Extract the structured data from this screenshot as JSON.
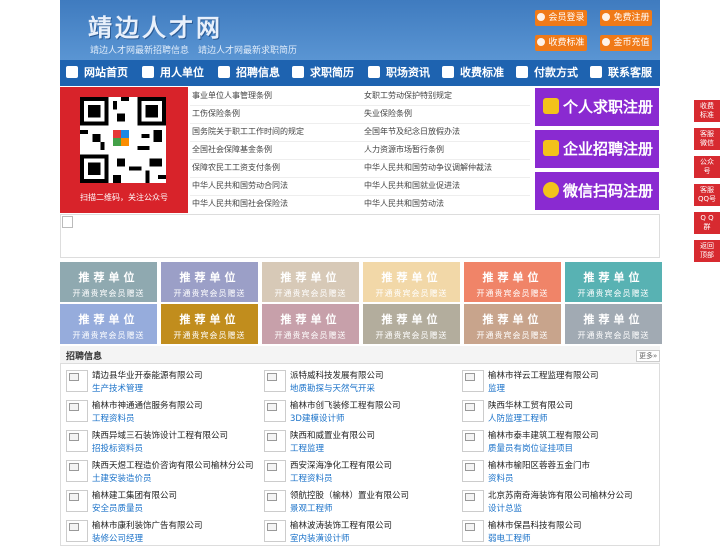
{
  "header": {
    "title": "靖边人才网",
    "subtitle": "靖边人才网最新招聘信息　靖边人才网最新求职简历",
    "buttons": [
      {
        "label": "会员登录",
        "icon": "user-icon"
      },
      {
        "label": "免费注册",
        "icon": "register-icon"
      },
      {
        "label": "收费标准",
        "icon": "price-icon"
      },
      {
        "label": "金币充值",
        "icon": "coin-icon"
      }
    ]
  },
  "nav": [
    {
      "label": "网站首页",
      "icon": "home-icon"
    },
    {
      "label": "用人单位",
      "icon": "building-icon"
    },
    {
      "label": "招聘信息",
      "icon": "recruit-icon"
    },
    {
      "label": "求职简历",
      "icon": "resume-icon"
    },
    {
      "label": "职场资讯",
      "icon": "news-icon"
    },
    {
      "label": "收费标准",
      "icon": "price-icon"
    },
    {
      "label": "付款方式",
      "icon": "payment-icon"
    },
    {
      "label": "联系客服",
      "icon": "phone-icon"
    }
  ],
  "qr_caption": "扫描二维码，关注公众号",
  "links_left": [
    "事业单位人事管理条例",
    "工伤保险条例",
    "国务院关于职工工作时间的规定",
    "全国社会保障基金条例",
    "保障农民工工资支付条例",
    "中华人民共和国劳动合同法",
    "中华人民共和国社会保险法"
  ],
  "links_right": [
    "女职工劳动保护特别规定",
    "失业保险条例",
    "全国年节及纪念日放假办法",
    "人力资源市场暂行条例",
    "中华人民共和国劳动争议调解仲裁法",
    "中华人民共和国就业促进法",
    "中华人民共和国劳动法"
  ],
  "register": [
    "个人求职注册",
    "企业招聘注册",
    "微信扫码注册"
  ],
  "recommend": {
    "title": "推荐单位",
    "note": "开通贵宾会员赠送",
    "colors": [
      "#8fa9b0",
      "#9b9fc7",
      "#d7c9b7",
      "#f2d8a8",
      "#f08468",
      "#58b2b3",
      "#96acdc",
      "#c18d1d",
      "#c7a0aa",
      "#b3ad9d",
      "#c8a48c",
      "#a1aab3"
    ]
  },
  "jobs": {
    "title": "招聘信息",
    "more": "更多»",
    "items": [
      {
        "company": "靖边县华业开泰能源有限公司",
        "position": "生产技术管理"
      },
      {
        "company": "派特威科技发展有限公司",
        "position": "地质勘探与天然气开采"
      },
      {
        "company": "榆林市祥云工程监理有限公司",
        "position": "监理"
      },
      {
        "company": "榆林市神通通信服务有限公司",
        "position": "工程资料员"
      },
      {
        "company": "榆林市创飞装修工程有限公司",
        "position": "3D建模设计师"
      },
      {
        "company": "陕西华林工贸有限公司",
        "position": "人防监理工程师"
      },
      {
        "company": "陕西异域三石装饰设计工程有限公司",
        "position": "招投标资料员"
      },
      {
        "company": "陕西和威置业有限公司",
        "position": "工程监理"
      },
      {
        "company": "榆林市泰丰建筑工程有限公司",
        "position": "质量员有岗位证挂项目"
      },
      {
        "company": "陕西天煜工程造价咨询有限公司榆林分公司",
        "position": "土建安装造价员"
      },
      {
        "company": "西安深海净化工程有限公司",
        "position": "工程资料员"
      },
      {
        "company": "榆林市榆阳区蓉蓉五金门市",
        "position": "资料员"
      },
      {
        "company": "榆林建工集团有限公司",
        "position": "安全员质量员"
      },
      {
        "company": "领航控股（榆林）置业有限公司",
        "position": "景观工程师"
      },
      {
        "company": "北京苏南奇海装饰有限公司榆林分公司",
        "position": "设计总监"
      },
      {
        "company": "榆林市康利装饰广告有限公司",
        "position": "装修公司经理"
      },
      {
        "company": "榆林波涛装饰工程有限公司",
        "position": "室内装潢设计师"
      },
      {
        "company": "榆林市保昌科技有限公司",
        "position": "弱电工程师"
      }
    ]
  },
  "side": [
    "收费\n标准",
    "客服\n微信",
    "公众\n号",
    "客服\nQQ号",
    "Q Q\n群",
    "返回\n顶部"
  ]
}
